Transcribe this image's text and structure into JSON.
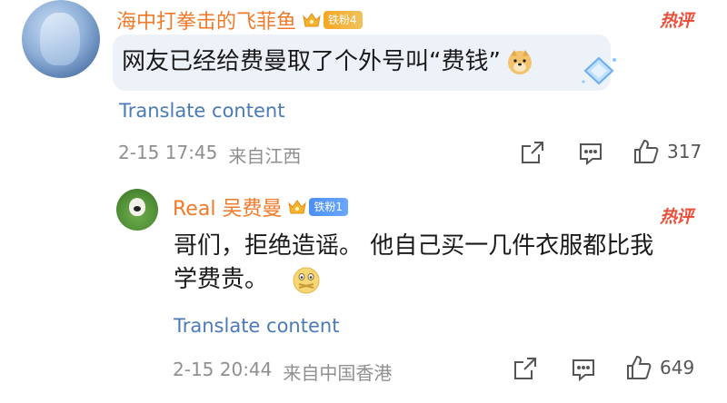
{
  "comment": {
    "username": "海中打拳击的飞菲鱼",
    "badge": "铁粉4",
    "hot_label": "热评",
    "text": "网友已经给费曼取了个外号叫“费钱”",
    "emoji": "doge-emoji",
    "translate": "Translate content",
    "time": "2-15 17:45",
    "location": "来自江西",
    "likes": "317"
  },
  "reply": {
    "username": "Real 吴费曼",
    "badge": "铁粉1",
    "hot_label": "热评",
    "text_line1": "哥们，拒绝造谣。 他自己买一几件衣服都比我",
    "text_line2": "学费贵。",
    "emoji": "zipper-mouth-emoji",
    "translate": "Translate content",
    "time": "2-15 20:44",
    "location": "来自中国香港",
    "likes": "649"
  },
  "colors": {
    "username": "#f07a2a",
    "link": "#4a7ab8",
    "hot": "#e8523a",
    "meta": "#8f8f8f"
  }
}
